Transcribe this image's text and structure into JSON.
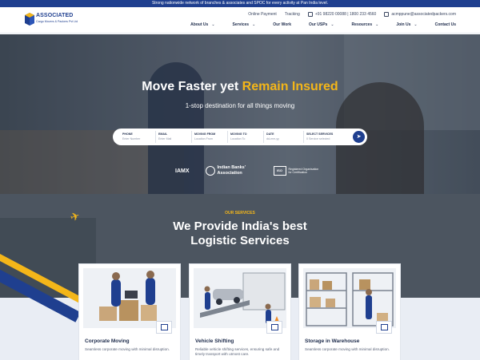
{
  "topbar": {
    "text": "Strong nationwide network of branches & associates and SPOC for every activity at Pan India level."
  },
  "logo": {
    "title": "ASSOCIATED",
    "subtitle": "Cargo Movers & Packers Pvt Ltd"
  },
  "top_links": {
    "online_payment": "Online Payment",
    "tracking": "Tracking",
    "phone": "+91 98220 00088 | 1800 233 4560",
    "email": "acmppune@associatedpackers.com"
  },
  "nav": [
    {
      "label": "About Us",
      "has_dropdown": true
    },
    {
      "label": "Services",
      "has_dropdown": true
    },
    {
      "label": "Our Work",
      "has_dropdown": false
    },
    {
      "label": "Our USPs",
      "has_dropdown": true
    },
    {
      "label": "Resources",
      "has_dropdown": true
    },
    {
      "label": "Join Us",
      "has_dropdown": true
    },
    {
      "label": "Contact Us",
      "has_dropdown": false
    }
  ],
  "hero": {
    "title_plain": "Move Faster yet ",
    "title_accent": "Remain Insured",
    "subtitle": "1-stop destination for all things moving"
  },
  "form": {
    "fields": [
      {
        "label": "PHONE",
        "value": "Enter Number"
      },
      {
        "label": "EMAIL",
        "value": "Enter Mail"
      },
      {
        "label": "MOVING FROM",
        "value": "Location From"
      },
      {
        "label": "MOVING TO",
        "value": "Location To"
      },
      {
        "label": "DATE",
        "value": "dd-mm-yy"
      },
      {
        "label": "SELECT SERVICES",
        "value": "0 Service selected"
      }
    ]
  },
  "badges": {
    "iamx": "IAMX",
    "iba": "Indian Banks' Association",
    "iso_mark": "ISO",
    "iso_text": "Registered Organisation for Certification"
  },
  "services": {
    "eyebrow": "OUR SERVICES",
    "title_line1": "We Provide India's best",
    "title_line2": "Logistic Services",
    "cards": [
      {
        "title": "Corporate Moving",
        "desc": "Seamless corporate moving with minimal disruption."
      },
      {
        "title": "Vehicle Shifting",
        "desc": "Reliable vehicle shifting services, ensuring safe and timely transport with utmost care."
      },
      {
        "title": "Storage in Warehouse",
        "desc": "Seamless corporate moving with minimal disruption."
      }
    ]
  },
  "colors": {
    "brand_blue": "#1f3f8f",
    "accent_yellow": "#f4b619"
  }
}
